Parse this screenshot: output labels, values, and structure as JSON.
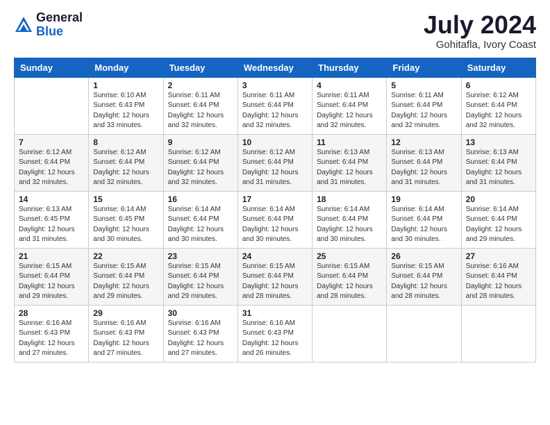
{
  "logo": {
    "general": "General",
    "blue": "Blue"
  },
  "header": {
    "month_year": "July 2024",
    "location": "Gohitafla, Ivory Coast"
  },
  "days_of_week": [
    "Sunday",
    "Monday",
    "Tuesday",
    "Wednesday",
    "Thursday",
    "Friday",
    "Saturday"
  ],
  "weeks": [
    [
      {
        "day": "",
        "info": ""
      },
      {
        "day": "1",
        "info": "Sunrise: 6:10 AM\nSunset: 6:43 PM\nDaylight: 12 hours\nand 33 minutes."
      },
      {
        "day": "2",
        "info": "Sunrise: 6:11 AM\nSunset: 6:44 PM\nDaylight: 12 hours\nand 32 minutes."
      },
      {
        "day": "3",
        "info": "Sunrise: 6:11 AM\nSunset: 6:44 PM\nDaylight: 12 hours\nand 32 minutes."
      },
      {
        "day": "4",
        "info": "Sunrise: 6:11 AM\nSunset: 6:44 PM\nDaylight: 12 hours\nand 32 minutes."
      },
      {
        "day": "5",
        "info": "Sunrise: 6:11 AM\nSunset: 6:44 PM\nDaylight: 12 hours\nand 32 minutes."
      },
      {
        "day": "6",
        "info": "Sunrise: 6:12 AM\nSunset: 6:44 PM\nDaylight: 12 hours\nand 32 minutes."
      }
    ],
    [
      {
        "day": "7",
        "info": "Sunrise: 6:12 AM\nSunset: 6:44 PM\nDaylight: 12 hours\nand 32 minutes."
      },
      {
        "day": "8",
        "info": "Sunrise: 6:12 AM\nSunset: 6:44 PM\nDaylight: 12 hours\nand 32 minutes."
      },
      {
        "day": "9",
        "info": "Sunrise: 6:12 AM\nSunset: 6:44 PM\nDaylight: 12 hours\nand 32 minutes."
      },
      {
        "day": "10",
        "info": "Sunrise: 6:12 AM\nSunset: 6:44 PM\nDaylight: 12 hours\nand 31 minutes."
      },
      {
        "day": "11",
        "info": "Sunrise: 6:13 AM\nSunset: 6:44 PM\nDaylight: 12 hours\nand 31 minutes."
      },
      {
        "day": "12",
        "info": "Sunrise: 6:13 AM\nSunset: 6:44 PM\nDaylight: 12 hours\nand 31 minutes."
      },
      {
        "day": "13",
        "info": "Sunrise: 6:13 AM\nSunset: 6:44 PM\nDaylight: 12 hours\nand 31 minutes."
      }
    ],
    [
      {
        "day": "14",
        "info": "Sunrise: 6:13 AM\nSunset: 6:45 PM\nDaylight: 12 hours\nand 31 minutes."
      },
      {
        "day": "15",
        "info": "Sunrise: 6:14 AM\nSunset: 6:45 PM\nDaylight: 12 hours\nand 30 minutes."
      },
      {
        "day": "16",
        "info": "Sunrise: 6:14 AM\nSunset: 6:44 PM\nDaylight: 12 hours\nand 30 minutes."
      },
      {
        "day": "17",
        "info": "Sunrise: 6:14 AM\nSunset: 6:44 PM\nDaylight: 12 hours\nand 30 minutes."
      },
      {
        "day": "18",
        "info": "Sunrise: 6:14 AM\nSunset: 6:44 PM\nDaylight: 12 hours\nand 30 minutes."
      },
      {
        "day": "19",
        "info": "Sunrise: 6:14 AM\nSunset: 6:44 PM\nDaylight: 12 hours\nand 30 minutes."
      },
      {
        "day": "20",
        "info": "Sunrise: 6:14 AM\nSunset: 6:44 PM\nDaylight: 12 hours\nand 29 minutes."
      }
    ],
    [
      {
        "day": "21",
        "info": "Sunrise: 6:15 AM\nSunset: 6:44 PM\nDaylight: 12 hours\nand 29 minutes."
      },
      {
        "day": "22",
        "info": "Sunrise: 6:15 AM\nSunset: 6:44 PM\nDaylight: 12 hours\nand 29 minutes."
      },
      {
        "day": "23",
        "info": "Sunrise: 6:15 AM\nSunset: 6:44 PM\nDaylight: 12 hours\nand 29 minutes."
      },
      {
        "day": "24",
        "info": "Sunrise: 6:15 AM\nSunset: 6:44 PM\nDaylight: 12 hours\nand 28 minutes."
      },
      {
        "day": "25",
        "info": "Sunrise: 6:15 AM\nSunset: 6:44 PM\nDaylight: 12 hours\nand 28 minutes."
      },
      {
        "day": "26",
        "info": "Sunrise: 6:15 AM\nSunset: 6:44 PM\nDaylight: 12 hours\nand 28 minutes."
      },
      {
        "day": "27",
        "info": "Sunrise: 6:16 AM\nSunset: 6:44 PM\nDaylight: 12 hours\nand 28 minutes."
      }
    ],
    [
      {
        "day": "28",
        "info": "Sunrise: 6:16 AM\nSunset: 6:43 PM\nDaylight: 12 hours\nand 27 minutes."
      },
      {
        "day": "29",
        "info": "Sunrise: 6:16 AM\nSunset: 6:43 PM\nDaylight: 12 hours\nand 27 minutes."
      },
      {
        "day": "30",
        "info": "Sunrise: 6:16 AM\nSunset: 6:43 PM\nDaylight: 12 hours\nand 27 minutes."
      },
      {
        "day": "31",
        "info": "Sunrise: 6:16 AM\nSunset: 6:43 PM\nDaylight: 12 hours\nand 26 minutes."
      },
      {
        "day": "",
        "info": ""
      },
      {
        "day": "",
        "info": ""
      },
      {
        "day": "",
        "info": ""
      }
    ]
  ]
}
